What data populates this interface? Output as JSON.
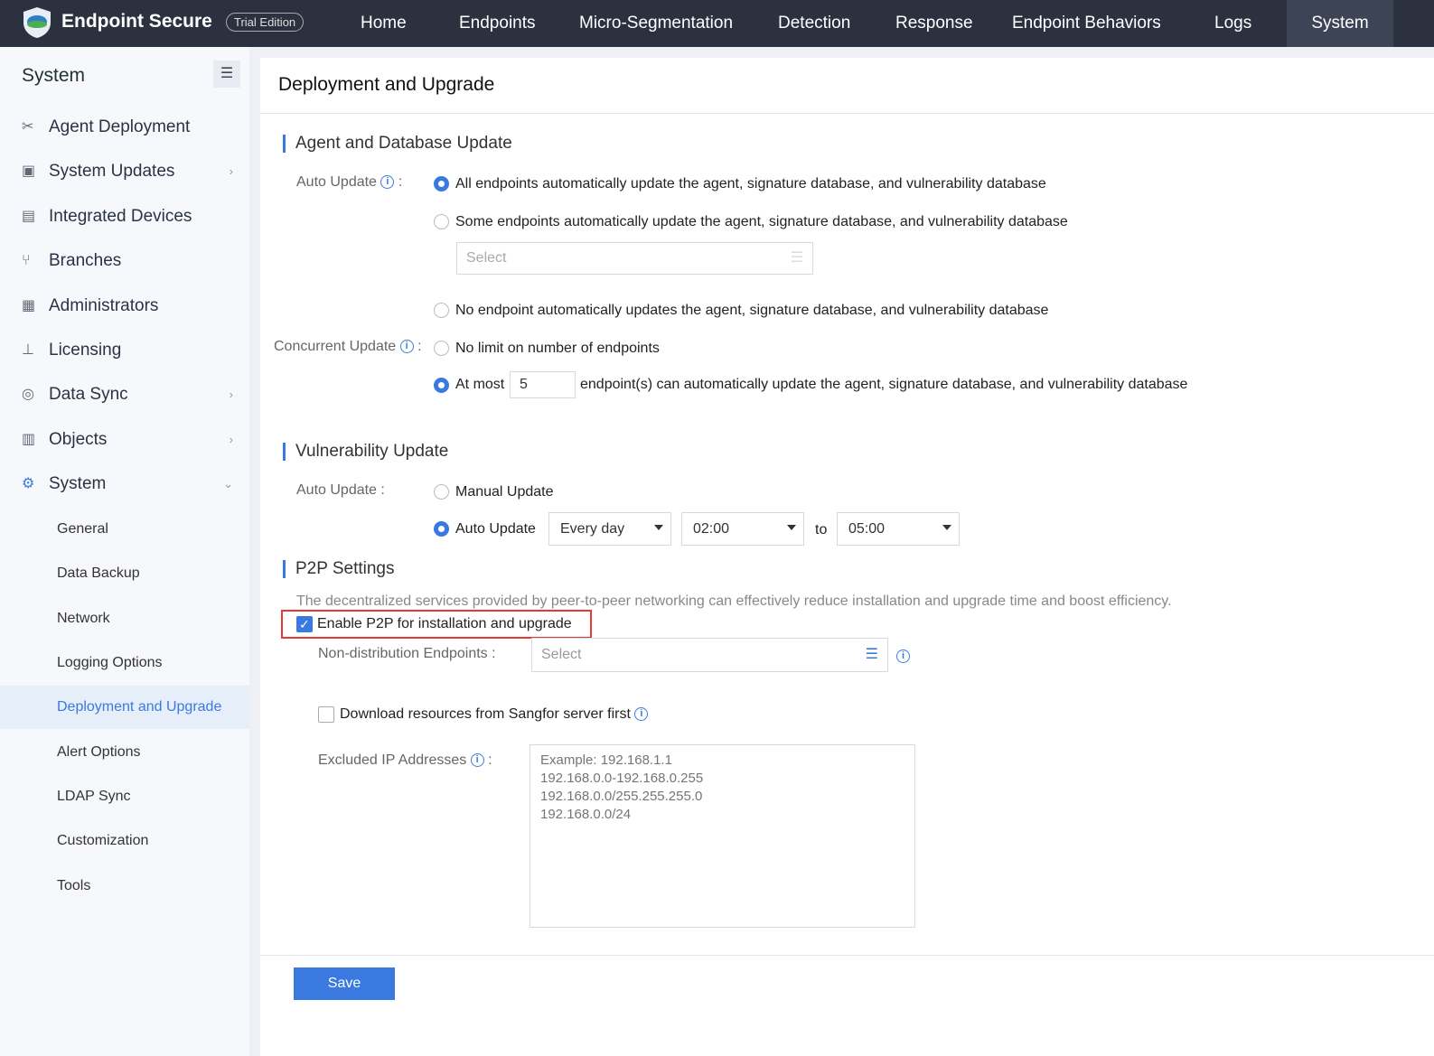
{
  "header": {
    "brand": "Endpoint Secure",
    "edition": "Trial Edition",
    "nav": [
      "Home",
      "Endpoints",
      "Micro-Segmentation",
      "Detection",
      "Response",
      "Endpoint Behaviors",
      "Logs",
      "System"
    ],
    "active": "System"
  },
  "sidebar": {
    "title": "System",
    "items": [
      {
        "label": "Agent Deployment",
        "icon": "tools-icon"
      },
      {
        "label": "System Updates",
        "icon": "update-icon"
      },
      {
        "label": "Integrated Devices",
        "icon": "device-icon"
      },
      {
        "label": "Branches",
        "icon": "branch-icon"
      },
      {
        "label": "Administrators",
        "icon": "admin-icon"
      },
      {
        "label": "Licensing",
        "icon": "license-icon"
      },
      {
        "label": "Data Sync",
        "icon": "sync-icon"
      },
      {
        "label": "Objects",
        "icon": "objects-icon"
      },
      {
        "label": "System",
        "icon": "gear-icon"
      }
    ],
    "sub": [
      "General",
      "Data Backup",
      "Network",
      "Logging Options",
      "Deployment and Upgrade",
      "Alert Options",
      "LDAP Sync",
      "Customization",
      "Tools"
    ],
    "active_sub": "Deployment and Upgrade"
  },
  "page": {
    "title": "Deployment and Upgrade",
    "agent": {
      "heading": "Agent and Database Update",
      "auto_label": "Auto Update",
      "opt1": "All endpoints automatically update the agent, signature database, and vulnerability database",
      "opt2": "Some endpoints automatically update the agent, signature database, and vulnerability database",
      "select_placeholder": "Select",
      "opt3": "No endpoint automatically updates the agent, signature database, and vulnerability database",
      "concurrent_label": "Concurrent Update",
      "c_opt1": "No limit on number of endpoints",
      "c_opt2_prefix": "At most",
      "c_value": "5",
      "c_opt2_suffix": "endpoint(s) can automatically update the agent, signature database, and vulnerability database"
    },
    "vuln": {
      "heading": "Vulnerability Update",
      "auto_label": "Auto Update :",
      "manual": "Manual Update",
      "auto": "Auto Update",
      "frequency": "Every day",
      "from": "02:00",
      "to_label": "to",
      "to": "05:00"
    },
    "p2p": {
      "heading": "P2P Settings",
      "description": "The decentralized services provided by peer-to-peer networking can effectively reduce installation and upgrade time and boost efficiency.",
      "enable": "Enable P2P for installation and upgrade",
      "enabled": true,
      "nondist_label": "Non-distribution Endpoints :",
      "nondist_placeholder": "Select",
      "download": "Download resources from Sangfor server first",
      "download_checked": false,
      "excluded_label": "Excluded IP Addresses",
      "excluded_placeholder": "Example: 192.168.1.1\n192.168.0.0-192.168.0.255\n192.168.0.0/255.255.255.0\n192.168.0.0/24"
    },
    "save": "Save"
  },
  "colors": {
    "accent": "#3a7ae0",
    "topbar": "#2b313f",
    "highlight": "#e53935"
  }
}
